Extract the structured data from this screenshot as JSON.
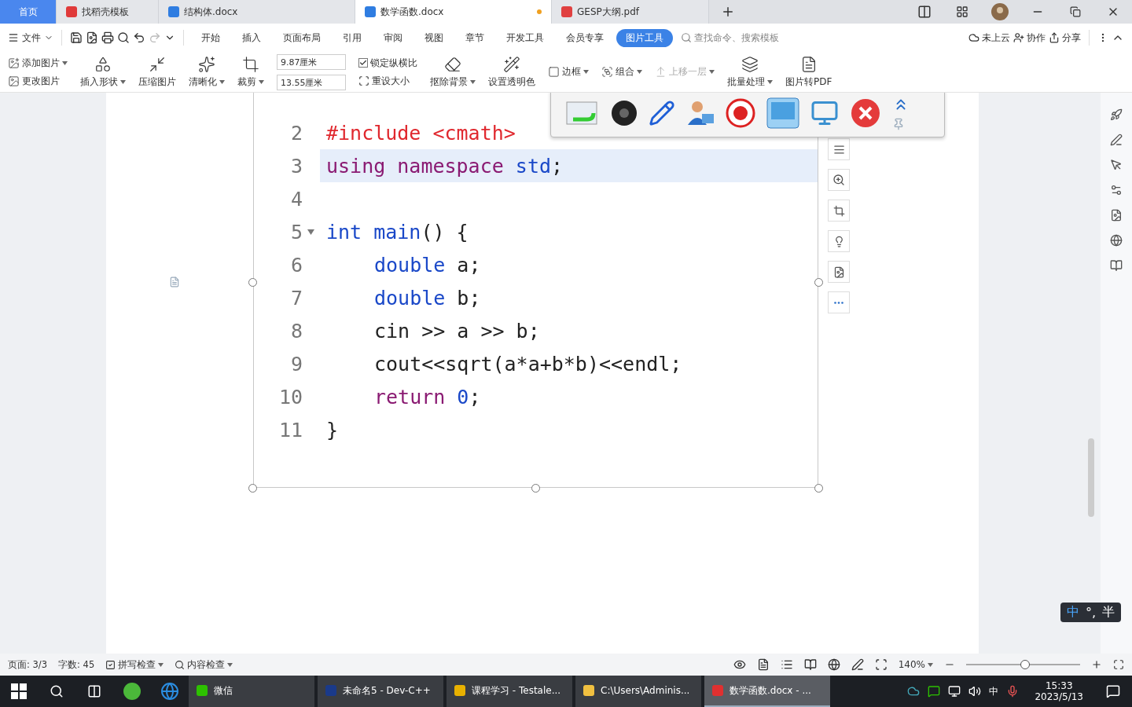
{
  "tabs": [
    {
      "label": "首页",
      "kind": "home",
      "selected": false,
      "unsaved": false
    },
    {
      "label": "找稻壳模板",
      "kind": "docer",
      "selected": false,
      "unsaved": false
    },
    {
      "label": "结构体.docx",
      "kind": "word",
      "selected": false,
      "unsaved": false
    },
    {
      "label": "数学函数.docx",
      "kind": "word",
      "selected": true,
      "unsaved": true
    },
    {
      "label": "GESP大纲.pdf",
      "kind": "pdf",
      "selected": false,
      "unsaved": false
    }
  ],
  "menu": {
    "file": "文件",
    "items": [
      {
        "label": "开始",
        "selected": false
      },
      {
        "label": "插入",
        "selected": false
      },
      {
        "label": "页面布局",
        "selected": false
      },
      {
        "label": "引用",
        "selected": false
      },
      {
        "label": "审阅",
        "selected": false
      },
      {
        "label": "视图",
        "selected": false
      },
      {
        "label": "章节",
        "selected": false
      },
      {
        "label": "开发工具",
        "selected": false
      },
      {
        "label": "会员专享",
        "selected": false
      },
      {
        "label": "图片工具",
        "selected": true
      }
    ],
    "search_placeholder": "查找命令、搜索模板",
    "cloud": "未上云",
    "collab": "协作",
    "share": "分享"
  },
  "ribbon": [
    {
      "kind": "stack",
      "items": [
        {
          "label": "添加图片",
          "dropdown": true,
          "disabled": false
        },
        {
          "label": "更改图片",
          "dropdown": false,
          "disabled": false
        }
      ]
    },
    {
      "kind": "big",
      "label": "插入形状",
      "dropdown": true
    },
    {
      "kind": "big",
      "label": "压缩图片",
      "dropdown": false
    },
    {
      "kind": "big",
      "label": "清晰化",
      "dropdown": true
    },
    {
      "kind": "big",
      "label": "裁剪",
      "dropdown": true
    },
    {
      "kind": "fields",
      "values": [
        "9.87厘米",
        "13.55厘米"
      ]
    },
    {
      "kind": "check",
      "label": "锁定纵横比",
      "checked": true,
      "action": "重设大小"
    },
    {
      "kind": "big",
      "label": "抠除背景",
      "dropdown": true
    },
    {
      "kind": "big",
      "label": "设置透明色",
      "dropdown": false
    },
    {
      "kind": "stack",
      "items": [
        {
          "label": "边框",
          "dropdown": true,
          "disabled": false
        }
      ]
    },
    {
      "kind": "stack",
      "items": [
        {
          "label": "组合",
          "dropdown": true,
          "disabled": false
        }
      ]
    },
    {
      "kind": "stack",
      "items": [
        {
          "label": "上移一层",
          "dropdown": true,
          "disabled": true
        }
      ]
    },
    {
      "kind": "big",
      "label": "批量处理",
      "dropdown": true
    },
    {
      "kind": "big",
      "label": "图片转PDF",
      "dropdown": false
    }
  ],
  "code": [
    {
      "number": "2",
      "selected": false,
      "fold": false,
      "indent": false,
      "tokens": [
        {
          "text": "#include <cmath>",
          "kind": "pre"
        }
      ]
    },
    {
      "number": "3",
      "selected": true,
      "fold": false,
      "indent": false,
      "tokens": [
        {
          "text": "using namespace ",
          "kind": "kw"
        },
        {
          "text": "std",
          "kind": "type"
        },
        {
          "text": ";",
          "kind": "plain"
        }
      ]
    },
    {
      "number": "4",
      "selected": false,
      "fold": false
    },
    {
      "number": "5",
      "selected": false,
      "fold": true,
      "indent": false,
      "tokens": [
        {
          "text": "int main",
          "kind": "type"
        },
        {
          "text": "() {",
          "kind": "plain"
        }
      ]
    },
    {
      "number": "6",
      "selected": false,
      "fold": false,
      "indent": true,
      "tokens": [
        {
          "text": "double",
          "kind": "type"
        },
        {
          "text": " a;",
          "kind": "plain"
        }
      ]
    },
    {
      "number": "7",
      "selected": false,
      "fold": false,
      "indent": true,
      "tokens": [
        {
          "text": "double",
          "kind": "type"
        },
        {
          "text": " b;",
          "kind": "plain"
        }
      ]
    },
    {
      "number": "8",
      "selected": false,
      "fold": false,
      "indent": true,
      "tokens": [
        {
          "text": "cin >> a >> b;",
          "kind": "plain"
        }
      ]
    },
    {
      "number": "9",
      "selected": false,
      "fold": false,
      "indent": true,
      "tokens": [
        {
          "text": "cout<<sqrt(a*a+b*b)<<endl;",
          "kind": "plain"
        }
      ]
    },
    {
      "number": "10",
      "selected": false,
      "fold": false,
      "indent": true,
      "tokens": [
        {
          "text": "return ",
          "kind": "kw"
        },
        {
          "text": "0",
          "kind": "num"
        },
        {
          "text": ";",
          "kind": "plain"
        }
      ]
    },
    {
      "number": "11",
      "selected": false,
      "fold": false,
      "indent": false,
      "tokens": [
        {
          "text": "}",
          "kind": "plain"
        }
      ]
    }
  ],
  "ime": {
    "mode": "中",
    "punct": "°,",
    "width": "半"
  },
  "status_bar": {
    "page": "页面: 3/3",
    "words": "字数: 45",
    "spell": "拼写检查",
    "content": "内容检查",
    "zoom": "140%",
    "level": 0.52
  },
  "taskbar": {
    "items": [
      {
        "label": "微信",
        "kind": "wechat",
        "selected": false
      },
      {
        "label": "未命名5 - Dev-C++",
        "kind": "dev",
        "selected": false
      },
      {
        "label": "课程学习 - Testale...",
        "kind": "chrome",
        "selected": false
      },
      {
        "label": "C:\\Users\\Adminis...",
        "kind": "folder",
        "selected": false
      },
      {
        "label": "数学函数.docx - ...",
        "kind": "wps",
        "selected": true
      }
    ],
    "lang": "中",
    "time": "15:33",
    "date": "2023/5/13"
  }
}
